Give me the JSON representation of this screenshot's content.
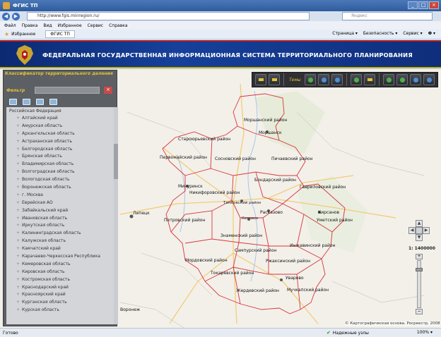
{
  "window": {
    "title": "ФГИС ТП",
    "buttons": [
      "_",
      "□",
      "×"
    ]
  },
  "address": {
    "url": "http://www.fgis.minregion.ru/",
    "search_placeholder": "Яндекс"
  },
  "menu": [
    "Файл",
    "Правка",
    "Вид",
    "Избранное",
    "Сервис",
    "Справка"
  ],
  "favorites": {
    "label": "Избранное",
    "tab": "ФГИС ТП",
    "commands": [
      "Страница ▾",
      "Безопасность ▾",
      "Сервис ▾",
      "❷ ▾"
    ]
  },
  "site": {
    "title": "ФЕДЕРАЛЬНАЯ ГОСУДАРСТВЕННАЯ ИНФОРМАЦИОННАЯ СИСТЕМА ТЕРРИТОРИАЛЬНОГО ПЛАНИРОВАНИЯ"
  },
  "panel": {
    "title": "Классификатор территориального деления",
    "filter_label": "Фильтр",
    "root": "Российская Федерация",
    "items": [
      "Алтайский край",
      "Амурская область",
      "Архангельская область",
      "Астраханская область",
      "Белгородская область",
      "Брянская область",
      "Владимирская область",
      "Волгоградская область",
      "Вологодская область",
      "Воронежская область",
      "г. Москва",
      "Еврейская АО",
      "Забайкальский край",
      "Ивановская область",
      "Иркутская область",
      "Калининградская область",
      "Калужская область",
      "Камчатский край",
      "Карачаево-Черкесская Республика",
      "Кемеровская область",
      "Кировская область",
      "Костромская область",
      "Краснодарский край",
      "Красноярский край",
      "Курганская область",
      "Курская область"
    ]
  },
  "toolbar": {
    "layers_label": "Темы"
  },
  "map": {
    "scale": "1: 1400000",
    "copyright": "© Картографическая основа. Росреестр, 2008",
    "districts": [
      "Моршанский район",
      "Моршанск",
      "Староюрьевский район",
      "Первомайский район",
      "Сосновский район",
      "Пичаевский район",
      "Бондарский район",
      "Мичуринск",
      "Никифоровский район",
      "Гавриловский район",
      "Тамбовский район",
      "Расказово",
      "Кирсанов",
      "Котовск",
      "Петровский район",
      "Уметский район",
      "Знаменский район",
      "Инжавинский район",
      "Сампурский район",
      "Мордовский район",
      "Ржаксинский район",
      "Токаревский район",
      "Уварово",
      "Жердевский район",
      "Мучкапский район",
      "Липецк",
      "Воронеж"
    ]
  },
  "status": {
    "left": "Готово",
    "zone": "Надежные узлы",
    "zoom": "100% ▾"
  }
}
